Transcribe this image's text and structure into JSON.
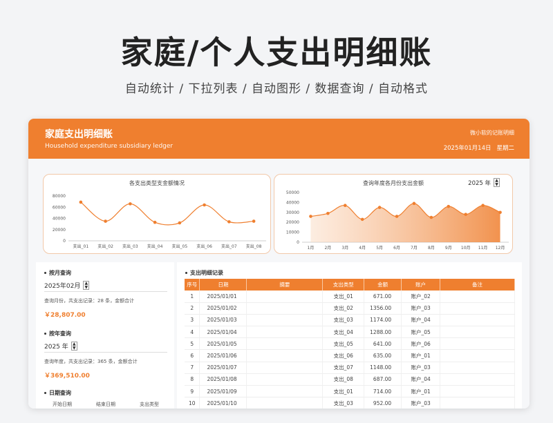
{
  "hero": {
    "title": "家庭/个人支出明细账",
    "subtitle": "自动统计  /  下拉列表  /  自动图形  /  数据查询  /  自动格式"
  },
  "header": {
    "title": "家庭支出明细账",
    "subtitle": "Household expenditure subsidiary ledger",
    "brand": "微小软的记账明细",
    "date": "2025年01月14日",
    "weekday": "星期二"
  },
  "colors": {
    "accent": "#ef7f2f"
  },
  "charts": [
    {
      "title": "各支出类型支金额情况",
      "chart_data": {
        "type": "line",
        "categories": [
          "支出_01",
          "支出_02",
          "支出_03",
          "支出_04",
          "支出_05",
          "支出_06",
          "支出_07",
          "支出_08"
        ],
        "values": [
          69000,
          35000,
          66000,
          33000,
          32000,
          64000,
          34000,
          35000
        ],
        "yticks": [
          "0",
          "20000",
          "40000",
          "60000",
          "80000"
        ],
        "ylim": [
          0,
          80000
        ]
      }
    },
    {
      "title": "查询年度各月份支出金额",
      "year_value": "2025 年",
      "chart_data": {
        "type": "area",
        "categories": [
          "1月",
          "2月",
          "3月",
          "4月",
          "5月",
          "6月",
          "7月",
          "8月",
          "9月",
          "10月",
          "11月",
          "12月"
        ],
        "values": [
          26000,
          29000,
          37000,
          23000,
          35000,
          26000,
          39000,
          25000,
          36000,
          28000,
          37000,
          30000
        ],
        "yticks": [
          "0",
          "10000",
          "20000",
          "30000",
          "40000",
          "50000"
        ],
        "ylim": [
          0,
          50000
        ]
      }
    }
  ],
  "monthly_query": {
    "label": "按月查询",
    "value": "2025年02月",
    "desc": "查询月份，共支出记录：28  条，金额合计",
    "amount": "￥28,807.00"
  },
  "yearly_query": {
    "label": "按年查询",
    "value": "2025 年",
    "desc": "查询年度，共支出记录：365  条，金额合计",
    "amount": "￥369,510.00"
  },
  "date_query": {
    "label": "日期查询",
    "columns": [
      "开始日期",
      "结束日期",
      "支出类型"
    ]
  },
  "ledger": {
    "label": "支出明细记录",
    "headers": [
      "序号",
      "日期",
      "摘要",
      "支出类型",
      "金额",
      "账户",
      "备注"
    ],
    "rows": [
      [
        "1",
        "2025/01/01",
        "",
        "支出_01",
        "671.00",
        "账户_02",
        ""
      ],
      [
        "2",
        "2025/01/02",
        "",
        "支出_02",
        "1356.00",
        "账户_03",
        ""
      ],
      [
        "3",
        "2025/01/03",
        "",
        "支出_03",
        "1174.00",
        "账户_04",
        ""
      ],
      [
        "4",
        "2025/01/04",
        "",
        "支出_04",
        "1288.00",
        "账户_05",
        ""
      ],
      [
        "5",
        "2025/01/05",
        "",
        "支出_05",
        "641.00",
        "账户_06",
        ""
      ],
      [
        "6",
        "2025/01/06",
        "",
        "支出_06",
        "635.00",
        "账户_01",
        ""
      ],
      [
        "7",
        "2025/01/07",
        "",
        "支出_07",
        "1148.00",
        "账户_03",
        ""
      ],
      [
        "8",
        "2025/01/08",
        "",
        "支出_08",
        "687.00",
        "账户_04",
        ""
      ],
      [
        "9",
        "2025/01/09",
        "",
        "支出_01",
        "714.00",
        "账户_01",
        ""
      ],
      [
        "10",
        "2025/01/10",
        "",
        "支出_03",
        "952.00",
        "账户_03",
        ""
      ]
    ]
  }
}
